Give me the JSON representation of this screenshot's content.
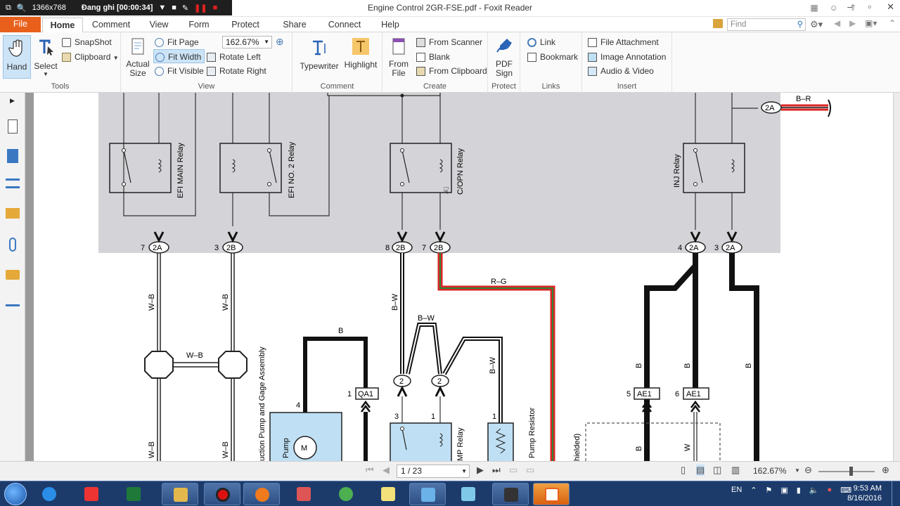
{
  "recorder": {
    "resolution": "1366x768",
    "status": "Đang ghi [00:00:34]"
  },
  "window": {
    "title": "Engine Control 2GR-FSE.pdf - Foxit Reader"
  },
  "menu": {
    "tabs": [
      "File",
      "Home",
      "Comment",
      "View",
      "Form",
      "Protect",
      "Share",
      "Connect",
      "Help"
    ],
    "active": "Home",
    "find_placeholder": "Find"
  },
  "ribbon": {
    "tools": {
      "label": "Tools",
      "hand": "Hand",
      "select": "Select",
      "snapshot": "SnapShot",
      "clipboard": "Clipboard"
    },
    "view": {
      "label": "View",
      "actual_size": "Actual Size",
      "fit_page": "Fit Page",
      "fit_width": "Fit Width",
      "fit_visible": "Fit Visible",
      "zoom": "162.67%",
      "rotate_left": "Rotate Left",
      "rotate_right": "Rotate Right"
    },
    "comment": {
      "label": "Comment",
      "typewriter": "Typewriter",
      "highlight": "Highlight"
    },
    "create": {
      "label": "Create",
      "from_file": "From File",
      "from_scanner": "From Scanner",
      "blank": "Blank",
      "from_clipboard": "From Clipboard"
    },
    "protect": {
      "label": "Protect",
      "pdf_sign": "PDF Sign"
    },
    "links": {
      "label": "Links",
      "link": "Link",
      "bookmark": "Bookmark"
    },
    "insert": {
      "label": "Insert",
      "file_attachment": "File Attachment",
      "image_annotation": "Image Annotation",
      "audio_video": "Audio & Video"
    }
  },
  "diagram": {
    "relays": [
      "EFI MAIN Relay",
      "EFI NO. 2 Relay",
      "C/OPN Relay",
      "INJ Relay"
    ],
    "connectors": [
      {
        "pin": "7",
        "name": "2A"
      },
      {
        "pin": "3",
        "name": "2B"
      },
      {
        "pin": "8",
        "name": "2B"
      },
      {
        "pin": "7",
        "name": "2B"
      },
      {
        "pin": "4",
        "name": "2A"
      },
      {
        "pin": "3",
        "name": "2A"
      }
    ],
    "top_connector": {
      "name": "2A",
      "wire": "B–R"
    },
    "wires": [
      "W–B",
      "W–B",
      "W–B",
      "B",
      "B–W",
      "B–W",
      "B–W",
      "R–G",
      "B",
      "B",
      "B",
      "B",
      "W",
      "W–B",
      "W–B"
    ],
    "junctions": [
      "2",
      "2"
    ],
    "lower_connectors": [
      {
        "pin": "1",
        "name": "QA1"
      },
      {
        "pin": "5",
        "name": "AE1"
      },
      {
        "pin": "6",
        "name": "AE1"
      }
    ],
    "components": {
      "pump_assembly": "uction Pump and Gage Assembly",
      "pump": "Pump",
      "motor": "M",
      "mp_relay": "MP Relay",
      "pump_resistor": "Pump Resistor",
      "shielded": "hielded)"
    },
    "pin_numbers": {
      "pump": "4",
      "relay_a": "3",
      "relay_b": "1",
      "resistor": "1"
    }
  },
  "status": {
    "page": "1 / 23",
    "zoom": "162.67%"
  },
  "taskbar": {
    "language": "EN",
    "time": "9:53 AM",
    "date": "8/16/2016"
  }
}
